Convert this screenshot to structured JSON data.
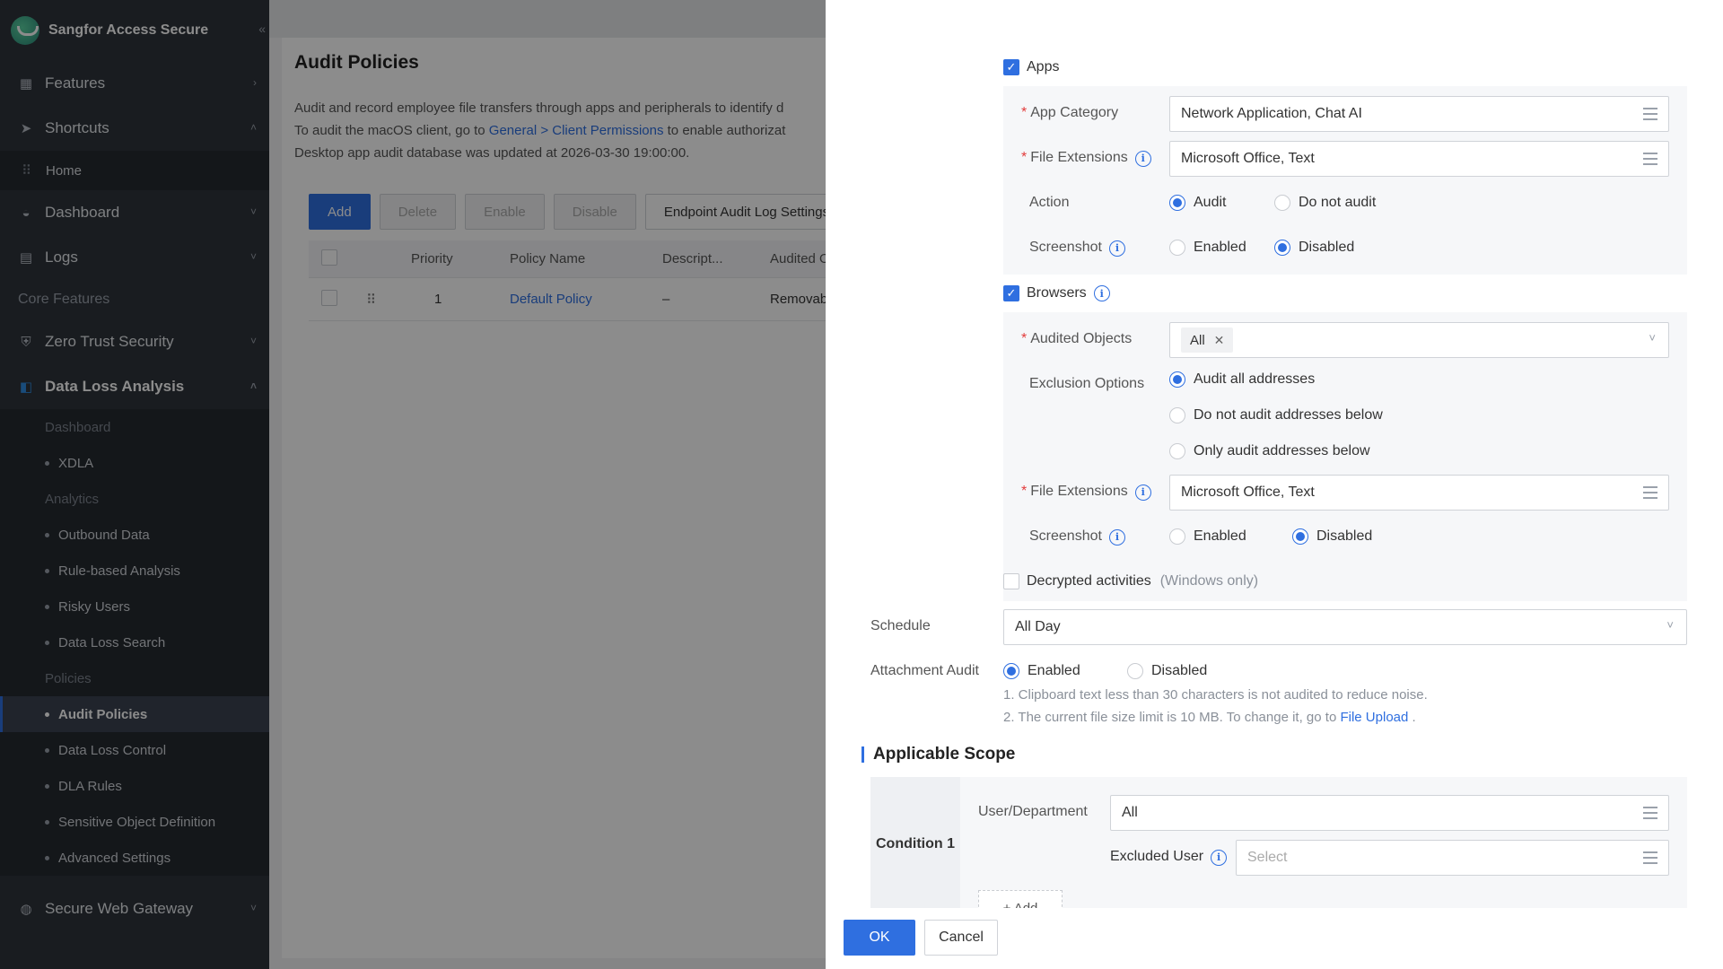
{
  "sidebar": {
    "brand": "Sangfor Access Secure",
    "collapse_icon": "double-chevron-left-icon",
    "top_items": [
      {
        "label": "Features",
        "icon": "grid-icon"
      },
      {
        "label": "Shortcuts",
        "icon": "send-icon"
      }
    ],
    "home": "Home",
    "dashboard": "Dashboard",
    "logs": "Logs",
    "core_features": "Core Features",
    "zero_trust": "Zero Trust Security",
    "dla": "Data Loss Analysis",
    "dla_sub": {
      "dashboard": "Dashboard",
      "xdla": "XDLA",
      "analytics": "Analytics",
      "outbound": "Outbound Data",
      "rule_based": "Rule-based Analysis",
      "risky_users": "Risky Users",
      "dl_search": "Data Loss Search",
      "policies": "Policies",
      "audit_policies": "Audit Policies",
      "dl_control": "Data Loss Control",
      "dla_rules": "DLA Rules",
      "sensitive_obj": "Sensitive Object Definition",
      "advanced": "Advanced Settings"
    },
    "swg": "Secure Web Gateway"
  },
  "main": {
    "title": "Audit Policies",
    "desc_line1": "Audit and record employee file transfers through apps and peripherals to identify d",
    "desc_line2_pre": "To audit the macOS client, go to ",
    "desc_line2_link": "General > Client Permissions",
    "desc_line2_post": " to enable authorizat",
    "desc_line3": "Desktop app audit database was updated at 2026-03-30 19:00:00.",
    "toolbar": {
      "add": "Add",
      "delete": "Delete",
      "enable": "Enable",
      "disable": "Disable",
      "log_settings": "Endpoint Audit Log Settings"
    },
    "table": {
      "headers": {
        "priority": "Priority",
        "name": "Policy Name",
        "desc": "Descript...",
        "audited": "Audited O"
      },
      "rows": [
        {
          "priority": "1",
          "name": "Default Policy",
          "desc": "–",
          "audited": "Removable"
        }
      ]
    }
  },
  "drawer": {
    "apps": {
      "label": "Apps",
      "checked": true,
      "app_category_label": "App Category",
      "app_category_value": "Network Application, Chat AI",
      "file_ext_label": "File Extensions",
      "file_ext_value": "Microsoft Office, Text",
      "action_label": "Action",
      "action_audit": "Audit",
      "action_no_audit": "Do not audit",
      "action_selected": "Audit",
      "screenshot_label": "Screenshot",
      "enabled": "Enabled",
      "disabled": "Disabled",
      "screenshot_selected": "Disabled"
    },
    "browsers": {
      "label": "Browsers",
      "checked": true,
      "audited_objects_label": "Audited Objects",
      "audited_objects_tag": "All",
      "exclusion_label": "Exclusion Options",
      "opt_all": "Audit all addresses",
      "opt_not": "Do not audit addresses below",
      "opt_only": "Only audit addresses below",
      "exclusion_selected": "Audit all addresses",
      "file_ext_label": "File Extensions",
      "file_ext_value": "Microsoft Office, Text",
      "screenshot_label": "Screenshot",
      "enabled": "Enabled",
      "disabled": "Disabled",
      "screenshot_selected": "Disabled"
    },
    "decrypted": {
      "label": "Decrypted activities",
      "note": "(Windows only)",
      "checked": false
    },
    "schedule": {
      "label": "Schedule",
      "value": "All Day"
    },
    "attachment": {
      "label": "Attachment Audit",
      "enabled": "Enabled",
      "disabled": "Disabled",
      "selected": "Enabled",
      "hint1": "1. Clipboard text less than 30 characters is not audited to reduce noise.",
      "hint2_pre": "2. The current file size limit is 10 MB. To change it, go to ",
      "hint2_link": "File Upload",
      "hint2_post": " ."
    },
    "scope": {
      "title": "Applicable Scope",
      "condition": "Condition 1",
      "user_dept_label": "User/Department",
      "user_dept_value": "All",
      "excluded_label": "Excluded User",
      "excluded_placeholder": "Select",
      "add": "+ Add"
    },
    "footer": {
      "ok": "OK",
      "cancel": "Cancel"
    }
  },
  "colors": {
    "primary": "#2f6fe0",
    "sidebar": "#2f343b",
    "required": "#e23c3c"
  }
}
